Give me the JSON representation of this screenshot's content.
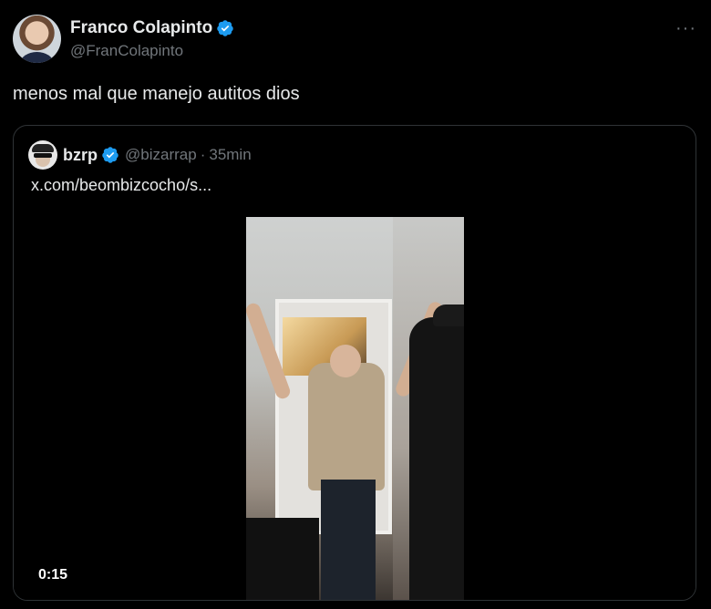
{
  "author": {
    "display_name": "Franco Colapinto",
    "handle": "@FranColapinto",
    "verified": true
  },
  "tweet_text": "menos mal que manejo autitos dios",
  "more_icon": "···",
  "quoted": {
    "display_name": "bzrp",
    "handle": "@bizarrap",
    "separator": "·",
    "time": "35min",
    "verified": true,
    "link_text": "x.com/beombizcocho/s...",
    "video": {
      "duration": "0:15"
    }
  },
  "colors": {
    "background": "#000000",
    "text_primary": "#e7e9ea",
    "text_secondary": "#71767b",
    "border": "#2f3336",
    "verified_blue": "#1d9bf0"
  }
}
